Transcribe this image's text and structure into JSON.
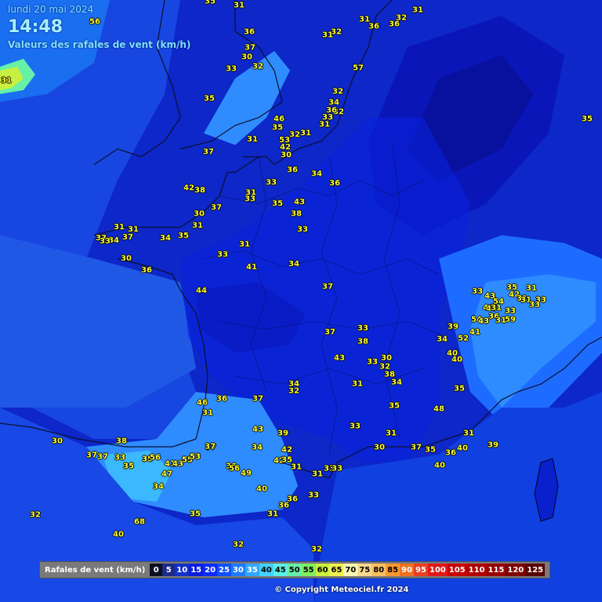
{
  "header": {
    "date": "lundi 20 mai 2024",
    "time": "14:48",
    "subtitle": "Valeurs des rafales de vent (km/h)"
  },
  "legend": {
    "title": "Rafales de vent (km/h)",
    "items": [
      {
        "label": "0",
        "color": "#0c1020",
        "text": "#ffffff"
      },
      {
        "label": "5",
        "color": "#1a2b8a",
        "text": "#ffffff"
      },
      {
        "label": "10",
        "color": "#1432c8",
        "text": "#ffffff"
      },
      {
        "label": "15",
        "color": "#0a1ee0",
        "text": "#ffffff"
      },
      {
        "label": "20",
        "color": "#0a2bff",
        "text": "#ffffff"
      },
      {
        "label": "25",
        "color": "#1050ff",
        "text": "#ffffff"
      },
      {
        "label": "30",
        "color": "#1e7cff",
        "text": "#ffffff"
      },
      {
        "label": "35",
        "color": "#30a8ff",
        "text": "#ffffff"
      },
      {
        "label": "40",
        "color": "#44d2ff",
        "text": "#000000"
      },
      {
        "label": "45",
        "color": "#5af0e6",
        "text": "#000000"
      },
      {
        "label": "50",
        "color": "#66f0a8",
        "text": "#000000"
      },
      {
        "label": "55",
        "color": "#80f060",
        "text": "#000000"
      },
      {
        "label": "60",
        "color": "#c8f040",
        "text": "#000000"
      },
      {
        "label": "65",
        "color": "#f0f050",
        "text": "#000000"
      },
      {
        "label": "70",
        "color": "#f8f8b0",
        "text": "#000000"
      },
      {
        "label": "75",
        "color": "#f8d890",
        "text": "#000000"
      },
      {
        "label": "80",
        "color": "#f8c060",
        "text": "#000000"
      },
      {
        "label": "85",
        "color": "#f89830",
        "text": "#000000"
      },
      {
        "label": "90",
        "color": "#f07020",
        "text": "#ffffff"
      },
      {
        "label": "95",
        "color": "#e84020",
        "text": "#ffffff"
      },
      {
        "label": "100",
        "color": "#e01818",
        "text": "#ffffff"
      },
      {
        "label": "105",
        "color": "#c80000",
        "text": "#ffffff"
      },
      {
        "label": "110",
        "color": "#b00000",
        "text": "#ffffff"
      },
      {
        "label": "115",
        "color": "#980000",
        "text": "#ffffff"
      },
      {
        "label": "120",
        "color": "#800000",
        "text": "#ffffff"
      },
      {
        "label": "125",
        "color": "#580000",
        "text": "#ffffff"
      }
    ]
  },
  "copyright": "© Copyright Meteociel.fr 2024",
  "stations": [
    {
      "v": "35"
    },
    {
      "v": "31"
    },
    {
      "v": "56"
    },
    {
      "v": "31"
    },
    {
      "v": "32"
    },
    {
      "v": "31"
    },
    {
      "v": "36"
    },
    {
      "v": "36"
    },
    {
      "v": "32"
    },
    {
      "v": "31"
    },
    {
      "v": "36"
    },
    {
      "v": "37"
    },
    {
      "v": "30"
    },
    {
      "v": "33"
    },
    {
      "v": "32"
    },
    {
      "v": "57"
    },
    {
      "v": "31"
    },
    {
      "v": "35"
    },
    {
      "v": "32"
    },
    {
      "v": "34"
    },
    {
      "v": "32"
    },
    {
      "v": "36"
    },
    {
      "v": "33"
    },
    {
      "v": "31"
    },
    {
      "v": "46"
    },
    {
      "v": "35"
    },
    {
      "v": "32"
    },
    {
      "v": "31"
    },
    {
      "v": "53"
    },
    {
      "v": "42"
    },
    {
      "v": "31"
    },
    {
      "v": "37"
    },
    {
      "v": "30"
    },
    {
      "v": "35"
    },
    {
      "v": "36"
    },
    {
      "v": "34"
    },
    {
      "v": "33"
    },
    {
      "v": "36"
    },
    {
      "v": "42"
    },
    {
      "v": "38"
    },
    {
      "v": "31"
    },
    {
      "v": "33"
    },
    {
      "v": "35"
    },
    {
      "v": "43"
    },
    {
      "v": "37"
    },
    {
      "v": "30"
    },
    {
      "v": "38"
    },
    {
      "v": "31"
    },
    {
      "v": "33"
    },
    {
      "v": "31"
    },
    {
      "v": "31"
    },
    {
      "v": "33"
    },
    {
      "v": "34"
    },
    {
      "v": "35"
    },
    {
      "v": "37"
    },
    {
      "v": "34"
    },
    {
      "v": "33"
    },
    {
      "v": "31"
    },
    {
      "v": "30"
    },
    {
      "v": "33"
    },
    {
      "v": "36"
    },
    {
      "v": "41"
    },
    {
      "v": "34"
    },
    {
      "v": "44"
    },
    {
      "v": "37"
    },
    {
      "v": "33"
    },
    {
      "v": "35"
    },
    {
      "v": "31"
    },
    {
      "v": "43"
    },
    {
      "v": "54"
    },
    {
      "v": "42"
    },
    {
      "v": "31"
    },
    {
      "v": "33"
    },
    {
      "v": "46"
    },
    {
      "v": "46"
    },
    {
      "v": "31"
    },
    {
      "v": "33"
    },
    {
      "v": "36"
    },
    {
      "v": "31"
    },
    {
      "v": "33"
    },
    {
      "v": "54"
    },
    {
      "v": "43"
    },
    {
      "v": "59"
    },
    {
      "v": "31"
    },
    {
      "v": "39"
    },
    {
      "v": "41"
    },
    {
      "v": "52"
    },
    {
      "v": "37"
    },
    {
      "v": "33"
    },
    {
      "v": "38"
    },
    {
      "v": "34"
    },
    {
      "v": "43"
    },
    {
      "v": "33"
    },
    {
      "v": "30"
    },
    {
      "v": "32"
    },
    {
      "v": "38"
    },
    {
      "v": "40"
    },
    {
      "v": "40"
    },
    {
      "v": "34"
    },
    {
      "v": "34"
    },
    {
      "v": "31"
    },
    {
      "v": "32"
    },
    {
      "v": "35"
    },
    {
      "v": "46"
    },
    {
      "v": "36"
    },
    {
      "v": "37"
    },
    {
      "v": "35"
    },
    {
      "v": "31"
    },
    {
      "v": "48"
    },
    {
      "v": "43"
    },
    {
      "v": "33"
    },
    {
      "v": "39"
    },
    {
      "v": "31"
    },
    {
      "v": "31"
    },
    {
      "v": "38"
    },
    {
      "v": "30"
    },
    {
      "v": "37"
    },
    {
      "v": "34"
    },
    {
      "v": "42"
    },
    {
      "v": "30"
    },
    {
      "v": "37"
    },
    {
      "v": "35"
    },
    {
      "v": "36"
    },
    {
      "v": "40"
    },
    {
      "v": "39"
    },
    {
      "v": "37"
    },
    {
      "v": "37"
    },
    {
      "v": "33"
    },
    {
      "v": "35"
    },
    {
      "v": "56"
    },
    {
      "v": "41"
    },
    {
      "v": "43"
    },
    {
      "v": "35"
    },
    {
      "v": "55"
    },
    {
      "v": "53"
    },
    {
      "v": "37"
    },
    {
      "v": "42"
    },
    {
      "v": "35"
    },
    {
      "v": "31"
    },
    {
      "v": "31"
    },
    {
      "v": "33"
    },
    {
      "v": "33"
    },
    {
      "v": "47"
    },
    {
      "v": "40"
    },
    {
      "v": "36"
    },
    {
      "v": "56"
    },
    {
      "v": "49"
    },
    {
      "v": "34"
    },
    {
      "v": "40"
    },
    {
      "v": "36"
    },
    {
      "v": "33"
    },
    {
      "v": "36"
    },
    {
      "v": "35"
    },
    {
      "v": "31"
    },
    {
      "v": "68"
    },
    {
      "v": "40"
    },
    {
      "v": "32"
    },
    {
      "v": "32"
    },
    {
      "v": "32"
    }
  ]
}
